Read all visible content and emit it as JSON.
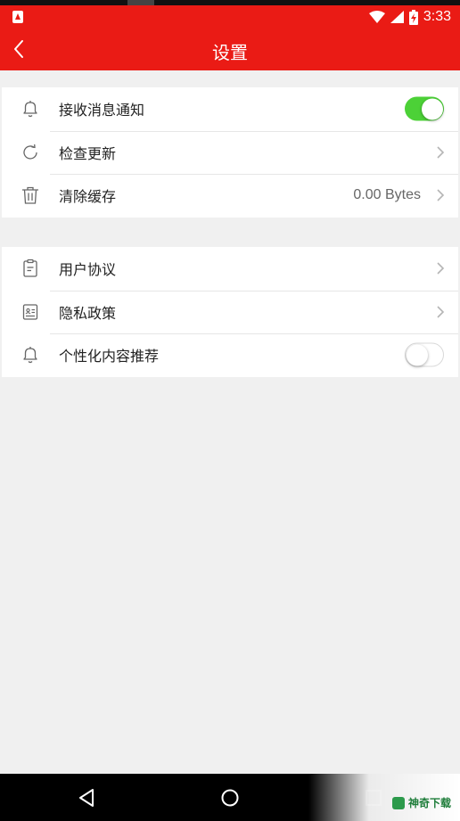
{
  "status_bar": {
    "time": "3:33",
    "icons": [
      "app-notification-icon",
      "wifi-icon",
      "signal-icon",
      "battery-charging-icon"
    ]
  },
  "app_bar": {
    "title": "设置",
    "back_icon": "chevron-left-icon"
  },
  "group1": {
    "notifications": {
      "label": "接收消息通知",
      "icon": "bell-icon",
      "toggle_on": true
    },
    "check_update": {
      "label": "检查更新",
      "icon": "refresh-icon"
    },
    "clear_cache": {
      "label": "清除缓存",
      "icon": "trash-icon",
      "value": "0.00 Bytes"
    }
  },
  "group2": {
    "user_agreement": {
      "label": "用户协议",
      "icon": "clipboard-icon"
    },
    "privacy_policy": {
      "label": "隐私政策",
      "icon": "id-card-icon"
    },
    "personalized": {
      "label": "个性化内容推荐",
      "icon": "bell-icon",
      "toggle_on": false
    }
  },
  "colors": {
    "brand_red": "#ea1b15",
    "toggle_on_green": "#4cd137",
    "background": "#f0f0f0"
  },
  "nav_bar": {
    "icons": [
      "nav-back-icon",
      "nav-home-icon",
      "nav-recents-icon"
    ]
  },
  "watermark": {
    "text": "神奇下载"
  }
}
